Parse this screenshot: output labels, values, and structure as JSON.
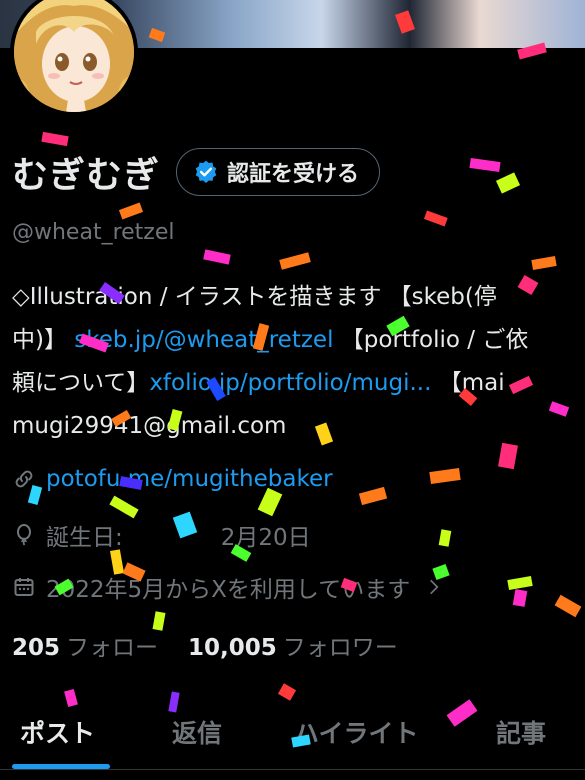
{
  "profile": {
    "display_name": "むぎむぎ",
    "verify_button_label": "認証を受ける",
    "handle": "@wheat_retzel"
  },
  "bio": {
    "line1": "◇Illustration / イラストを描きます 【skeb(停",
    "line2_prefix": "中)】",
    "line2_link": "skeb.jp/@wheat_retzel",
    "line2_suffix": "【portfolio / ご依",
    "line3_prefix": "頼について】",
    "line3_link": "xfolio.jp/portfolio/mugi...",
    "line3_suffix": "【mai",
    "line4": "mugi29941@gmail.com"
  },
  "meta": {
    "link": "potofu.me/mugithebaker",
    "birthday_label": "誕生日:",
    "birthday_value": "2月20日",
    "joined": "2022年5月からXを利用しています"
  },
  "counts": {
    "following_value": "205",
    "following_label": "フォロー",
    "followers_value": "10,005",
    "followers_label": "フォロワー"
  },
  "tabs": [
    {
      "label": "ポスト",
      "active": true
    },
    {
      "label": "返信",
      "active": false
    },
    {
      "label": "ハイライト",
      "active": false
    },
    {
      "label": "記事",
      "active": false
    }
  ],
  "colors": {
    "background": "#000000",
    "primary_text": "#e7e9ea",
    "secondary_text": "#71767b",
    "link": "#1d9bf0",
    "accent": "#1d9bf0"
  },
  "icons": {
    "verify": "verified-badge-icon",
    "link": "link-icon",
    "birthday": "balloon-icon",
    "joined": "calendar-icon",
    "chevron": "chevron-right-icon"
  }
}
